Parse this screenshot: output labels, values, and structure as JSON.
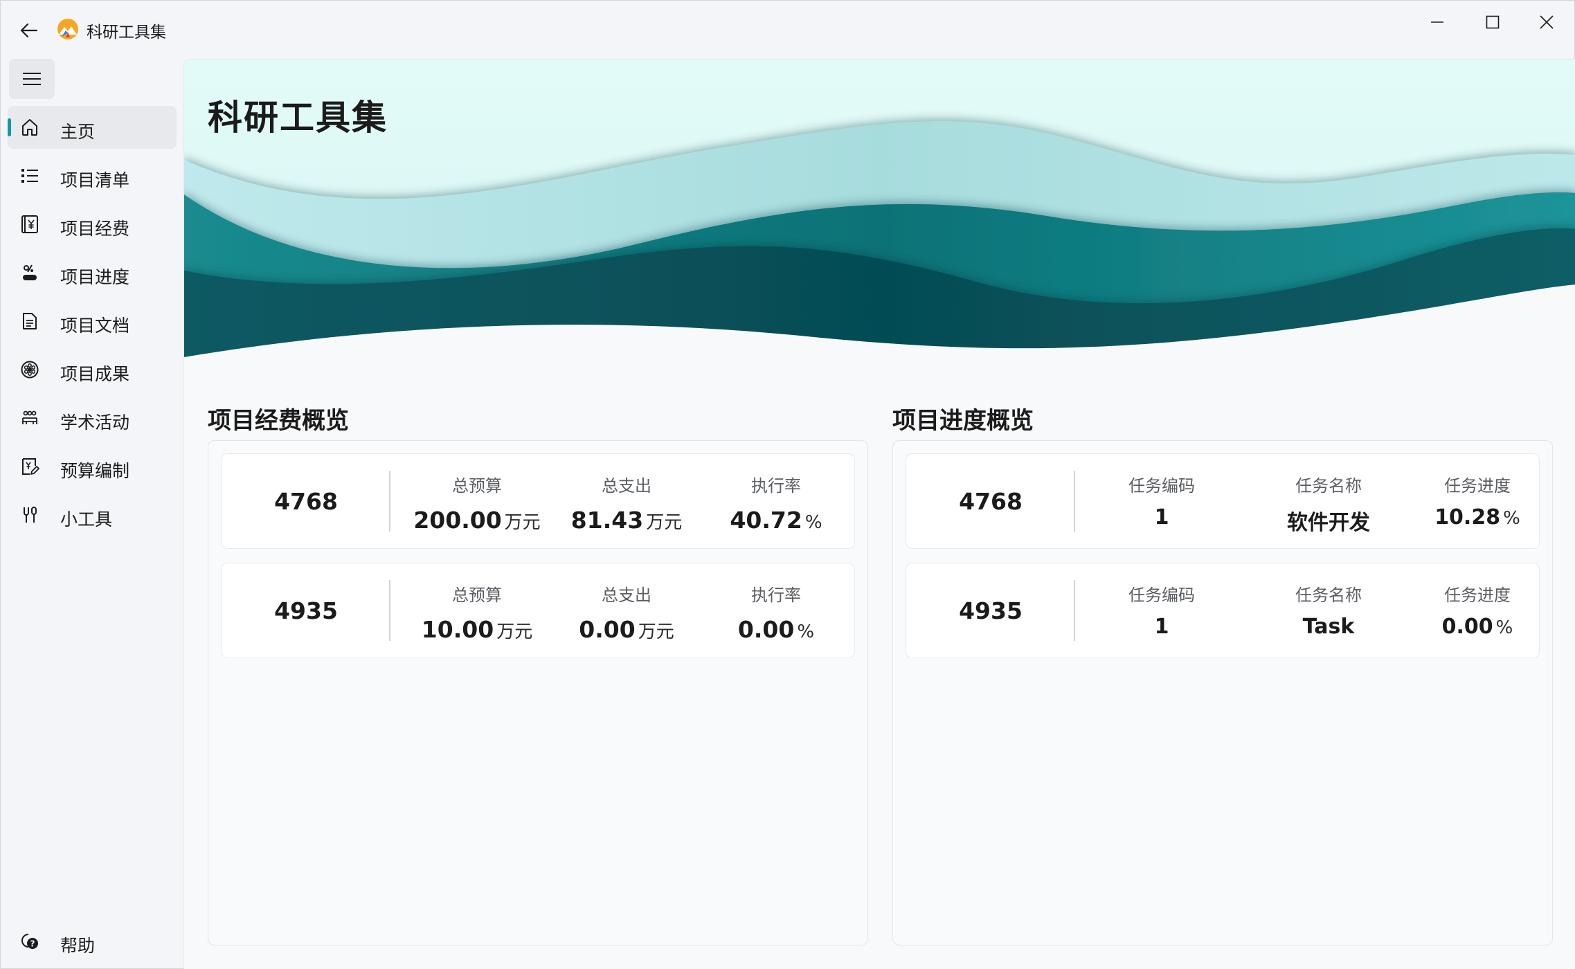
{
  "app": {
    "title": "科研工具集"
  },
  "sidebar": {
    "items": [
      {
        "label": "主页",
        "icon": "home-icon",
        "active": true
      },
      {
        "label": "项目清单",
        "icon": "list-icon"
      },
      {
        "label": "项目经费",
        "icon": "yuan-icon"
      },
      {
        "label": "项目进度",
        "icon": "progress-icon"
      },
      {
        "label": "项目文档",
        "icon": "document-icon"
      },
      {
        "label": "项目成果",
        "icon": "achievement-icon"
      },
      {
        "label": "学术活动",
        "icon": "people-icon"
      },
      {
        "label": "预算编制",
        "icon": "budget-icon"
      },
      {
        "label": "小工具",
        "icon": "tools-icon"
      }
    ],
    "help": {
      "label": "帮助",
      "icon": "help-icon"
    }
  },
  "hero": {
    "title": "科研工具集"
  },
  "funding": {
    "title": "项目经费概览",
    "cards": [
      {
        "id": "4768",
        "budget_label": "总预算",
        "budget": "200.00",
        "budget_unit": "万元",
        "spent_label": "总支出",
        "spent": "81.43",
        "spent_unit": "万元",
        "rate_label": "执行率",
        "rate": "40.72",
        "rate_unit": "%"
      },
      {
        "id": "4935",
        "budget_label": "总预算",
        "budget": "10.00",
        "budget_unit": "万元",
        "spent_label": "总支出",
        "spent": "0.00",
        "spent_unit": "万元",
        "rate_label": "执行率",
        "rate": "0.00",
        "rate_unit": "%"
      }
    ]
  },
  "progress": {
    "title": "项目进度概览",
    "cards": [
      {
        "id": "4768",
        "code_label": "任务编码",
        "code": "1",
        "name_label": "任务名称",
        "name": "软件开发",
        "progress_label": "任务进度",
        "progress": "10.28",
        "progress_unit": "%"
      },
      {
        "id": "4935",
        "code_label": "任务编码",
        "code": "1",
        "name_label": "任务名称",
        "name": "Task",
        "progress_label": "任务进度",
        "progress": "0.00",
        "progress_unit": "%"
      }
    ]
  },
  "colors": {
    "accent": "#0d9aa0",
    "wave_light": "#bfe8ea",
    "wave_mid": "#118a8f",
    "wave_dark": "#08555e"
  }
}
